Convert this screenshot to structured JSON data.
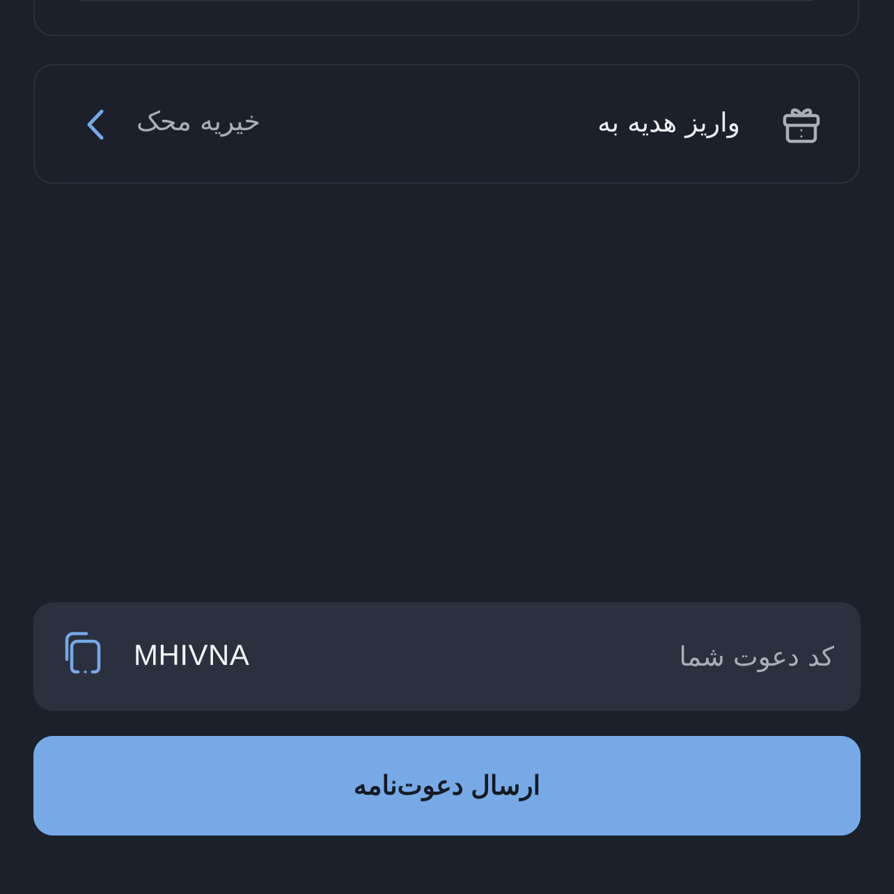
{
  "gift": {
    "title": "واریز هدیه به",
    "value": "خیریه محک",
    "icon": "gift-icon",
    "chevron_icon": "chevron-left-icon"
  },
  "invite": {
    "label": "کد دعوت شما",
    "code": "MHIVNA",
    "copy_icon": "copy-icon"
  },
  "send_button": {
    "label": "ارسال دعوت‌نامه"
  },
  "colors": {
    "background": "#1b202a",
    "card_border": "#2c323d",
    "invite_box": "#2a303e",
    "accent": "#77a9e6",
    "primary_text": "#eceef2",
    "secondary_text": "#a9aeb8",
    "button_text": "#141a24"
  }
}
